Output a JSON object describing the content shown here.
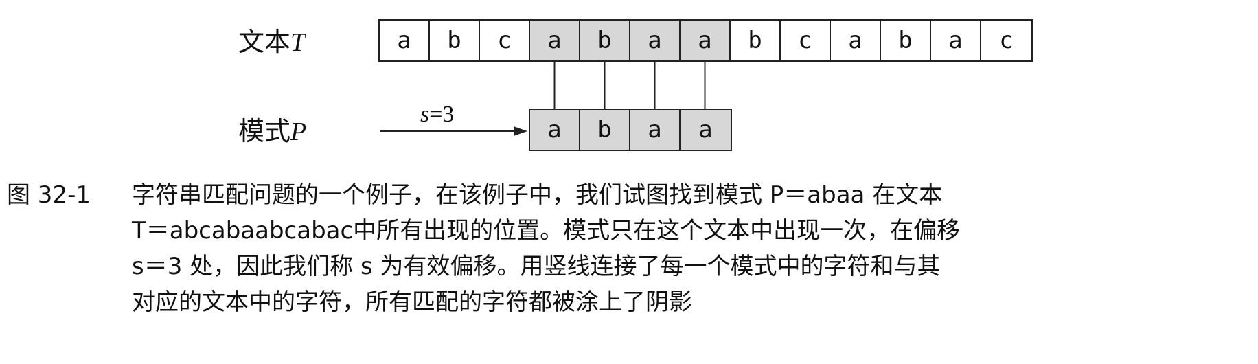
{
  "text_label": {
    "prefix": "文本",
    "var": "T"
  },
  "pattern_label": {
    "prefix": "模式",
    "var": "P"
  },
  "text_chars": [
    "a",
    "b",
    "c",
    "a",
    "b",
    "a",
    "a",
    "b",
    "c",
    "a",
    "b",
    "a",
    "c"
  ],
  "pattern_chars": [
    "a",
    "b",
    "a",
    "a"
  ],
  "shift": {
    "var": "s",
    "rest": "=3",
    "value": 3
  },
  "caption": {
    "number": "图 32-1",
    "lines": [
      "字符串匹配问题的一个例子，在该例子中，我们试图找到模式 P＝abaa 在文本",
      "T＝abcabaabcabac中所有出现的位置。模式只在这个文本中出现一次，在偏移",
      "s＝3 处，因此我们称 s 为有效偏移。用竖线连接了每一个模式中的字符和与其",
      "对应的文本中的字符，所有匹配的字符都被涂上了阴影"
    ]
  }
}
